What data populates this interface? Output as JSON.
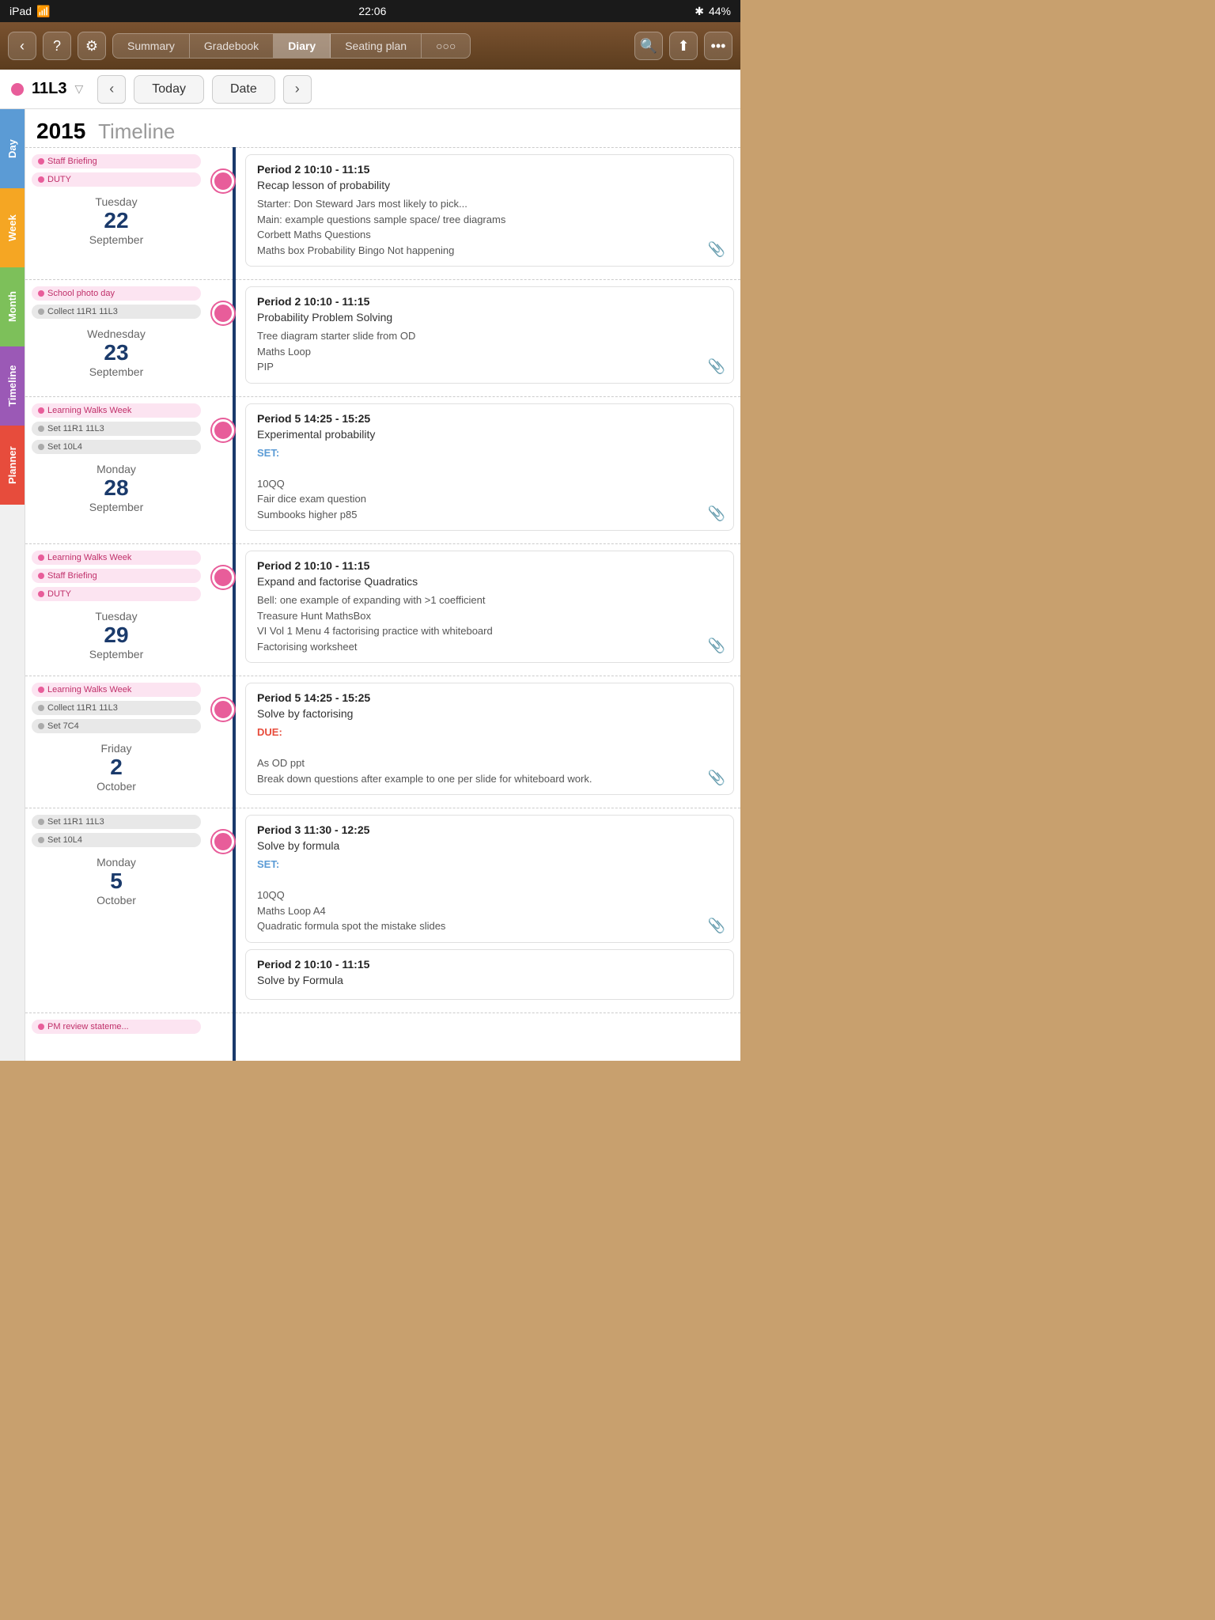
{
  "status": {
    "carrier": "iPad",
    "wifi": true,
    "time": "22:06",
    "bluetooth": true,
    "battery": "44%"
  },
  "nav": {
    "back_label": "‹",
    "help_label": "?",
    "settings_label": "⚙",
    "tabs": [
      "Summary",
      "Gradebook",
      "Diary",
      "Seating plan",
      "○○○"
    ],
    "active_tab": "Diary",
    "search_label": "🔍",
    "share_label": "⬆",
    "more_label": "•••"
  },
  "class_bar": {
    "class_name": "11L3",
    "today_label": "Today",
    "date_label": "Date"
  },
  "year_header": {
    "year": "2015",
    "timeline": "Timeline"
  },
  "sections": [
    {
      "date_day": "Tuesday",
      "date_num": "22",
      "date_month": "September",
      "left_events": [
        {
          "tag": "pink",
          "label": "Staff Briefing"
        },
        {
          "tag": "pink",
          "label": "DUTY"
        }
      ],
      "periods": [
        {
          "header": "Period 2    10:10 - 11:15",
          "title": "Recap lesson of probability",
          "body": "Starter: Don Steward Jars most likely to pick...\nMain: example questions sample space/ tree diagrams\nCorbett Maths Questions\nMaths box Probability Bingo Not happening",
          "set_label": null,
          "due_label": null,
          "has_attach": true
        }
      ]
    },
    {
      "date_day": "Wednesday",
      "date_num": "23",
      "date_month": "September",
      "left_events": [
        {
          "tag": "pink",
          "label": "School photo day"
        },
        {
          "tag": "gray",
          "label": "Collect 11R1 11L3"
        }
      ],
      "periods": [
        {
          "header": "Period 2    10:10 - 11:15",
          "title": "Probability Problem Solving",
          "body": "Tree diagram starter slide from OD\nMaths Loop\nPIP",
          "set_label": null,
          "due_label": null,
          "has_attach": true
        }
      ]
    },
    {
      "date_day": "Monday",
      "date_num": "28",
      "date_month": "September",
      "left_events": [
        {
          "tag": "pink",
          "label": "Learning Walks Week"
        },
        {
          "tag": "gray",
          "label": "Set 11R1 11L3"
        },
        {
          "tag": "gray",
          "label": "Set 10L4"
        }
      ],
      "periods": [
        {
          "header": "Period 5    14:25 - 15:25",
          "title": "Experimental probability",
          "set_label": "SET:",
          "body": "10QQ\nFair dice exam question\nSumbooks higher p85",
          "due_label": null,
          "has_attach": true
        }
      ]
    },
    {
      "date_day": "Tuesday",
      "date_num": "29",
      "date_month": "September",
      "left_events": [
        {
          "tag": "pink",
          "label": "Learning Walks Week"
        },
        {
          "tag": "pink",
          "label": "Staff Briefing"
        },
        {
          "tag": "pink",
          "label": "DUTY"
        }
      ],
      "periods": [
        {
          "header": "Period 2    10:10 - 11:15",
          "title": "Expand and factorise Quadratics",
          "body": "Bell: one example of expanding with >1 coefficient\nTreasure Hunt MathsBox\nVI Vol 1 Menu 4 factorising practice with whiteboard\nFactorising worksheet",
          "set_label": null,
          "due_label": null,
          "has_attach": true
        }
      ]
    },
    {
      "date_day": "Friday",
      "date_num": "2",
      "date_month": "October",
      "left_events": [
        {
          "tag": "pink",
          "label": "Learning Walks Week"
        },
        {
          "tag": "gray",
          "label": "Collect 11R1 11L3"
        },
        {
          "tag": "gray",
          "label": "Set 7C4"
        }
      ],
      "periods": [
        {
          "header": "Period 5    14:25 - 15:25",
          "title": "Solve by factorising",
          "set_label": null,
          "due_label": "DUE:",
          "body": "As OD ppt\nBreak down questions after example to one per slide for whiteboard work.",
          "has_attach": true
        }
      ]
    },
    {
      "date_day": "Monday",
      "date_num": "5",
      "date_month": "October",
      "left_events": [
        {
          "tag": "gray",
          "label": "Set 11R1 11L3"
        },
        {
          "tag": "gray",
          "label": "Set 10L4"
        }
      ],
      "periods": [
        {
          "header": "Period 3    11:30 - 12:25",
          "title": "Solve by formula",
          "set_label": "SET:",
          "body": "10QQ\nMaths Loop A4\nQuadratic formula spot the mistake slides",
          "due_label": null,
          "has_attach": true
        },
        {
          "header": "Period 2    10:10 - 11:15",
          "title": "Solve by Formula",
          "body": "",
          "set_label": null,
          "due_label": null,
          "has_attach": false
        }
      ]
    }
  ]
}
